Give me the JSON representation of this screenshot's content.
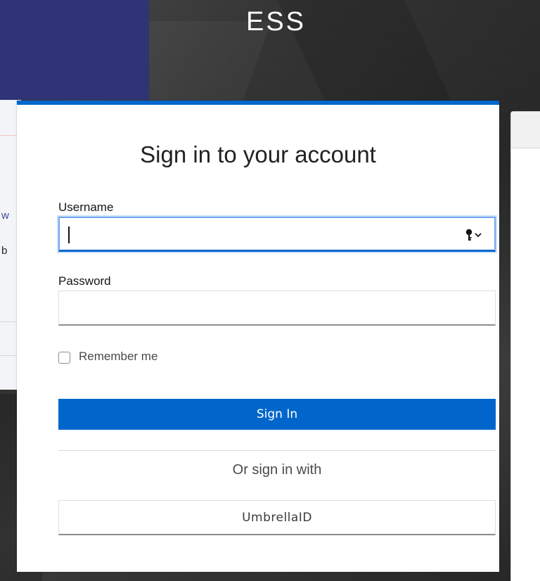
{
  "brand": {
    "title": "ESS"
  },
  "behind": {
    "text_1": "w",
    "text_2": "b"
  },
  "login": {
    "title": "Sign in to your account",
    "username_label": "Username",
    "username_value": "",
    "password_label": "Password",
    "password_value": "",
    "remember_me_label": "Remember me",
    "sign_in_label": "Sign In",
    "or_sign_in_with": "Or sign in with",
    "providers": [
      {
        "label": "UmbrellaID"
      }
    ]
  },
  "colors": {
    "primary": "#0066cc",
    "focus_ring": "#6fa8ef",
    "behind_header": "#2f3476"
  },
  "icons": {
    "username_autofill": "key-dropdown-icon"
  }
}
